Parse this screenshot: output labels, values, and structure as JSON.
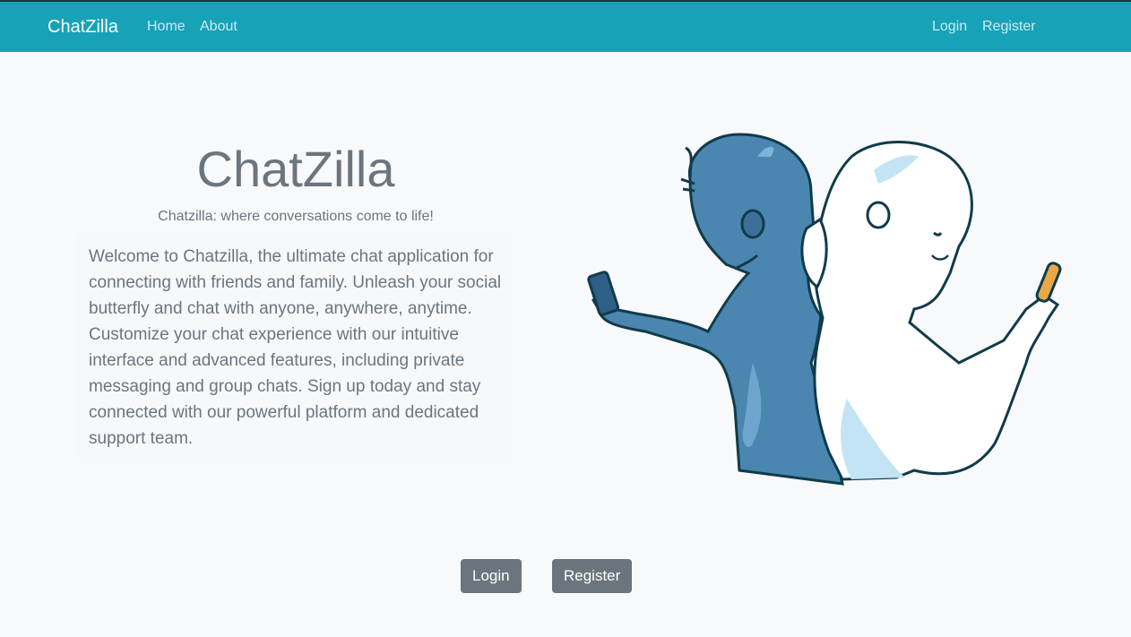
{
  "navbar": {
    "brand": "ChatZilla",
    "links": {
      "home": "Home",
      "about": "About",
      "login": "Login",
      "register": "Register"
    }
  },
  "hero": {
    "title": "ChatZilla",
    "tagline": "Chatzilla: where conversations come to life!",
    "description": "Welcome to Chatzilla, the ultimate chat application for connecting with friends and family. Unleash your social butterfly and chat with anyone, anywhere, anytime. Customize your chat experience with our intuitive interface and advanced features, including private messaging and group chats. Sign up today and stay connected with our powerful platform and dedicated support team."
  },
  "buttons": {
    "login": "Login",
    "register": "Register"
  },
  "colors": {
    "navbar": "#17a2b8",
    "background": "#f8f9fa",
    "text_muted": "#6c757d",
    "button": "#6c757d",
    "boy": "#4a86b0",
    "girl_shade": "#c3e4f5",
    "outline": "#103b4a",
    "phone_accent": "#e8a848"
  },
  "illustration": {
    "name": "two-people-using-phones-illustration"
  }
}
